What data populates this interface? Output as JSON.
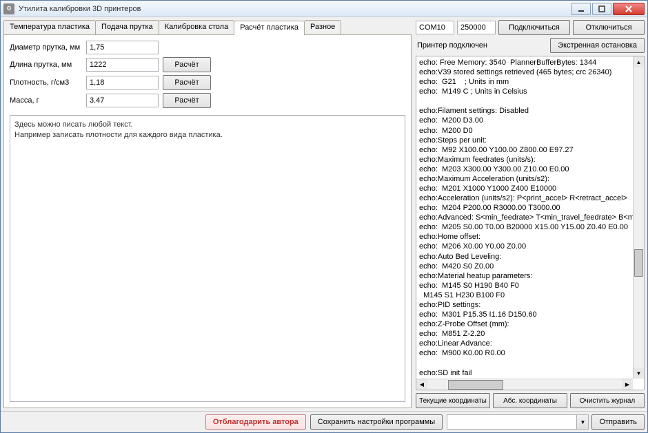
{
  "window": {
    "title": "Утилита калибровки 3D принтеров"
  },
  "tabs": {
    "items": [
      {
        "label": "Температура пластика"
      },
      {
        "label": "Подача прутка"
      },
      {
        "label": "Калибровка стола"
      },
      {
        "label": "Расчёт пластика"
      },
      {
        "label": "Разное"
      }
    ],
    "active_index": 3
  },
  "form": {
    "diameter": {
      "label": "Диаметр прутка, мм",
      "value": "1,75"
    },
    "length": {
      "label": "Длина прутка, мм",
      "value": "1222",
      "button": "Расчёт"
    },
    "density": {
      "label": "Плотность, г/см3",
      "value": "1,18",
      "button": "Расчёт"
    },
    "mass": {
      "label": "Масса, г",
      "value": "3.47",
      "button": "Расчёт"
    }
  },
  "note": "Здесь можно писать любой текст.\nНапример записать плотности для каждого вида пластика.",
  "connection": {
    "port": "COM10",
    "baud": "250000",
    "connect": "Подключиться",
    "disconnect": "Отключиться",
    "status": "Принтер подключен",
    "estop": "Экстренная остановка"
  },
  "log": "echo: Free Memory: 3540  PlannerBufferBytes: 1344\necho:V39 stored settings retrieved (465 bytes; crc 26340)\necho:  G21    ; Units in mm\necho:  M149 C ; Units in Celsius\n\necho:Filament settings: Disabled\necho:  M200 D3.00\necho:  M200 D0\necho:Steps per unit:\necho:  M92 X100.00 Y100.00 Z800.00 E97.27\necho:Maximum feedrates (units/s):\necho:  M203 X300.00 Y300.00 Z10.00 E0.00\necho:Maximum Acceleration (units/s2):\necho:  M201 X1000 Y1000 Z400 E10000\necho:Acceleration (units/s2): P<print_accel> R<retract_accel>\necho:  M204 P200.00 R3000.00 T3000.00\necho:Advanced: S<min_feedrate> T<min_travel_feedrate> B<m\necho:  M205 S0.00 T0.00 B20000 X15.00 Y15.00 Z0.40 E0.00\necho:Home offset:\necho:  M206 X0.00 Y0.00 Z0.00\necho:Auto Bed Leveling:\necho:  M420 S0 Z0.00\necho:Material heatup parameters:\necho:  M145 S0 H190 B40 F0\n  M145 S1 H230 B100 F0\necho:PID settings:\necho:  M301 P15.35 I1.16 D150.60\necho:Z-Probe Offset (mm):\necho:  M851 Z-2.20\necho:Linear Advance:\necho:  M900 K0.00 R0.00\n\necho:SD init fail\n",
  "log_actions": {
    "current": "Текущие координаты",
    "abs": "Абс. координаты",
    "clear": "Очистить журнал"
  },
  "bottom": {
    "thank": "Отблагодарить автора",
    "save": "Сохранить настройки программы",
    "send": "Отправить",
    "command": ""
  }
}
